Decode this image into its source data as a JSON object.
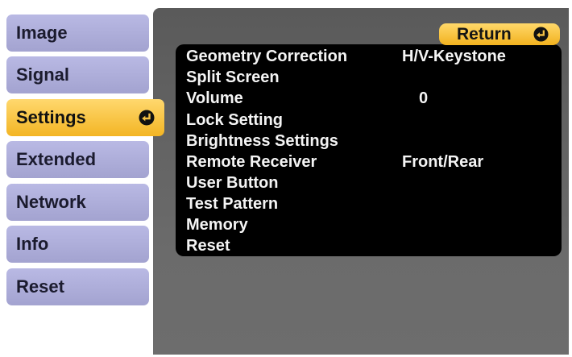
{
  "sidebar": {
    "items": [
      {
        "label": "Image"
      },
      {
        "label": "Signal"
      },
      {
        "label": "Settings",
        "active": true
      },
      {
        "label": "Extended"
      },
      {
        "label": "Network"
      },
      {
        "label": "Info"
      },
      {
        "label": "Reset"
      }
    ]
  },
  "return_button": {
    "label": "Return"
  },
  "menu": {
    "rows": [
      {
        "label": "Geometry Correction",
        "value": "H/V-Keystone"
      },
      {
        "label": "Split Screen",
        "value": ""
      },
      {
        "label": "Volume",
        "value": "0"
      },
      {
        "label": "Lock Setting",
        "value": ""
      },
      {
        "label": "Brightness Settings",
        "value": ""
      },
      {
        "label": "Remote Receiver",
        "value": "Front/Rear"
      },
      {
        "label": "User Button",
        "value": ""
      },
      {
        "label": "Test Pattern",
        "value": ""
      },
      {
        "label": "Memory",
        "value": ""
      },
      {
        "label": "Reset",
        "value": ""
      }
    ]
  },
  "icons": {
    "enter": "enter-icon"
  },
  "colors": {
    "active_tab": "#f5b82a",
    "inactive_tab": "#b0b0dc",
    "panel": "#5e5e5e",
    "list": "#000000"
  }
}
